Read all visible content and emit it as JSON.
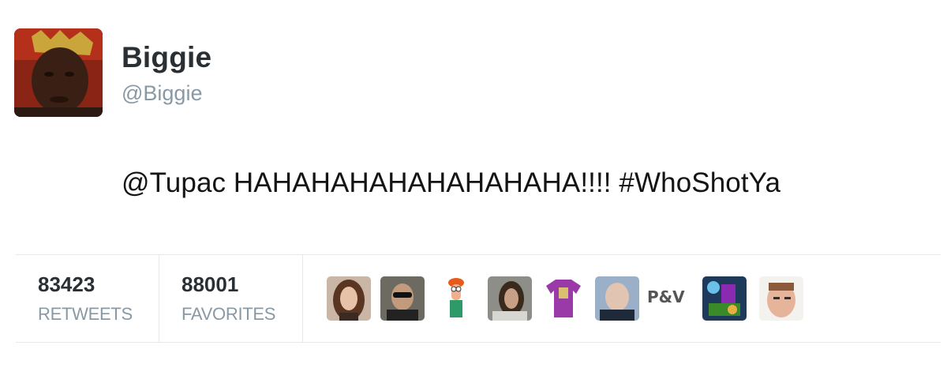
{
  "tweet": {
    "display_name": "Biggie",
    "screen_name": "@Biggie",
    "text": "@Tupac HAHAHAHAHAHAHAHAHA!!!!  #WhoShotYa"
  },
  "stats": {
    "retweets_count": "83423",
    "retweets_label": "RETWEETS",
    "favorites_count": "88001",
    "favorites_label": "FAVORITES"
  },
  "favoriters": {
    "text_avatar_label": "P&V"
  }
}
